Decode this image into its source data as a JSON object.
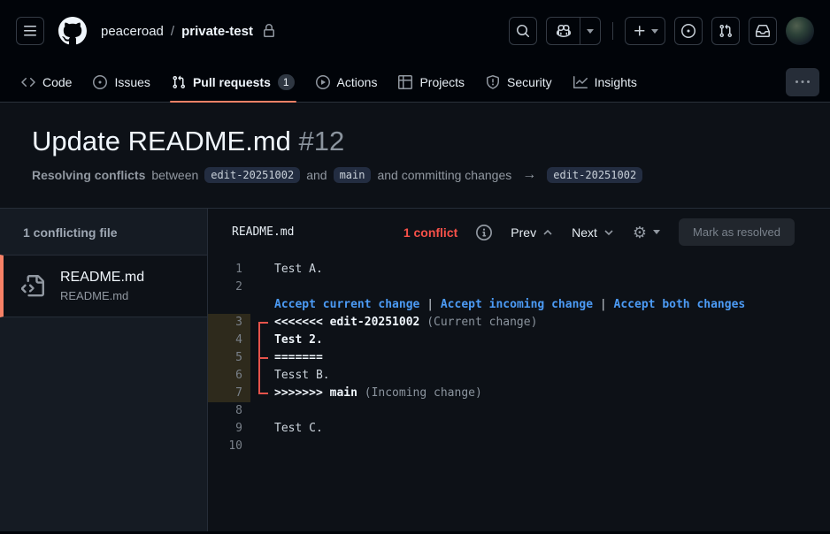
{
  "colors": {
    "accent_orange": "#f78166",
    "conflict_red": "#f85149",
    "codelens_blue": "#4c9bf5",
    "header_bg": "#010409",
    "page_bg": "#0d1117"
  },
  "top_nav": {
    "owner": "peaceroad",
    "separator": "/",
    "repo": "private-test"
  },
  "repo_tabs": [
    {
      "label": "Code"
    },
    {
      "label": "Issues"
    },
    {
      "label": "Pull requests",
      "badge": "1"
    },
    {
      "label": "Actions"
    },
    {
      "label": "Projects"
    },
    {
      "label": "Security"
    },
    {
      "label": "Insights"
    }
  ],
  "pr_header": {
    "title": "Update README.md",
    "number": "#12",
    "subtitle_bold": "Resolving conflicts",
    "between": "between",
    "branch_head": "edit-20251002",
    "and1": "and",
    "branch_base": "main",
    "committing": "and committing changes",
    "arrow": "→",
    "branch_target": "edit-20251002"
  },
  "sidebar": {
    "heading": "1 conflicting file",
    "files": [
      {
        "name": "README.md",
        "path": "README.md",
        "selected": true
      }
    ]
  },
  "editor": {
    "filename": "README.md",
    "conflict_count": "1 conflict",
    "prev_label": "Prev",
    "next_label": "Next",
    "resolve_button": "Mark as resolved",
    "codelens_actions": [
      "Accept current change",
      "Accept incoming change",
      "Accept both changes"
    ],
    "codelens_separator": "|",
    "lines": [
      {
        "num": "1",
        "segments": [
          {
            "t": "Test A.",
            "s": "n"
          }
        ]
      },
      {
        "num": "2",
        "segments": []
      },
      {
        "type": "codelens"
      },
      {
        "num": "3",
        "conflict": true,
        "bracket": "start",
        "segments": [
          {
            "t": "<<<<<<< edit-20251002 ",
            "s": "b"
          },
          {
            "t": "(Current change)",
            "s": "m"
          }
        ]
      },
      {
        "num": "4",
        "conflict": true,
        "bracket": "line",
        "segments": [
          {
            "t": "Test 2.",
            "s": "b"
          }
        ]
      },
      {
        "num": "5",
        "conflict": true,
        "bracket": "mid",
        "segments": [
          {
            "t": "=======",
            "s": "b"
          }
        ]
      },
      {
        "num": "6",
        "conflict": true,
        "bracket": "line",
        "segments": [
          {
            "t": "Tesst B.",
            "s": "n"
          }
        ]
      },
      {
        "num": "7",
        "conflict": true,
        "bracket": "end",
        "segments": [
          {
            "t": ">>>>>>> main ",
            "s": "b"
          },
          {
            "t": "(Incoming change)",
            "s": "m"
          }
        ]
      },
      {
        "num": "8",
        "segments": []
      },
      {
        "num": "9",
        "segments": [
          {
            "t": "Test C.",
            "s": "n"
          }
        ]
      },
      {
        "num": "10",
        "segments": []
      }
    ]
  }
}
